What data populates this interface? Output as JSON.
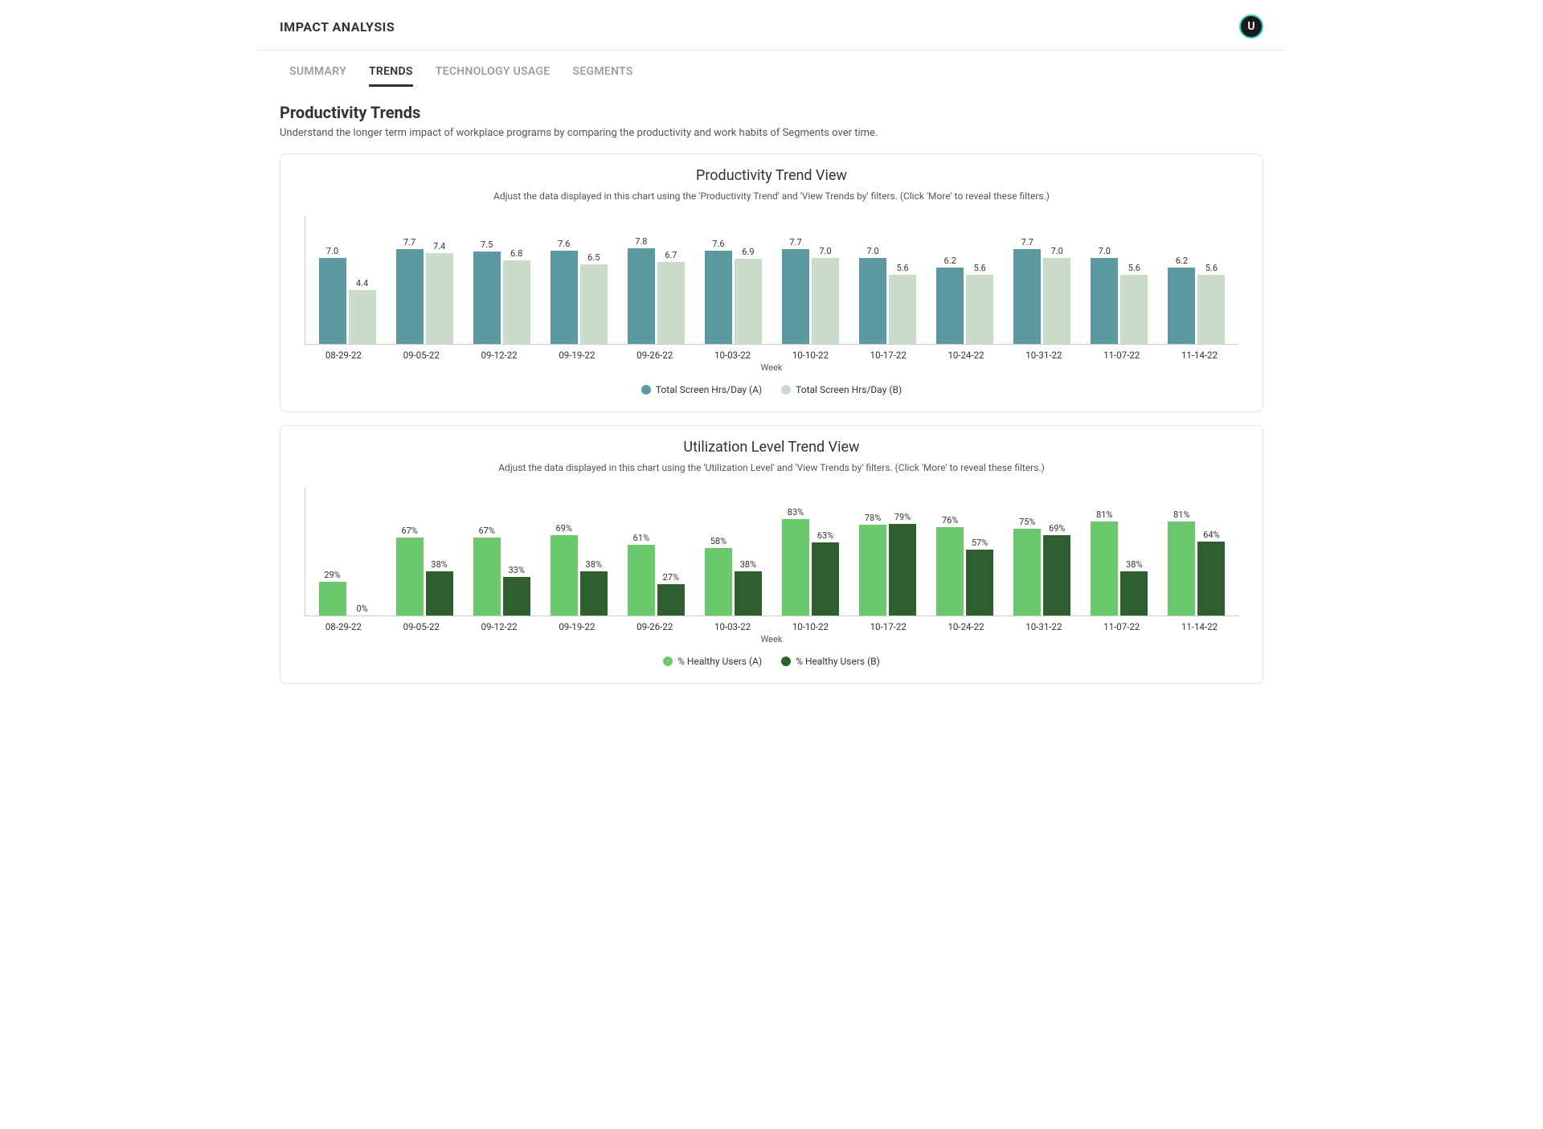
{
  "header": {
    "title": "IMPACT ANALYSIS",
    "avatar_initial": "U"
  },
  "tabs": {
    "items": [
      "SUMMARY",
      "TRENDS",
      "TECHNOLOGY USAGE",
      "SEGMENTS"
    ],
    "active_index": 1
  },
  "section": {
    "title": "Productivity Trends",
    "subtitle": "Understand the longer term impact of workplace programs by comparing the productivity and work habits of Segments over time."
  },
  "colors": {
    "teal_a": "#5a9aa0",
    "teal_b": "#c9dcc9",
    "green_a": "#6cc86c",
    "green_b": "#2f5f2f"
  },
  "chart1": {
    "title": "Productivity Trend View",
    "subtitle": "Adjust the data displayed in this chart using the 'Productivity Trend' and 'View Trends by' filters. (Click 'More' to reveal these filters.)",
    "xlabel": "Week",
    "legend_a": "Total Screen Hrs/Day (A)",
    "legend_b": "Total Screen Hrs/Day (B)"
  },
  "chart2": {
    "title": "Utilization Level Trend View",
    "subtitle": "Adjust the data displayed in this chart using the 'Utilization Level' and 'View Trends by' filters. (Click 'More' to reveal these filters.)",
    "xlabel": "Week",
    "legend_a": "% Healthy Users (A)",
    "legend_b": "% Healthy Users (B)"
  },
  "chart_data": [
    {
      "type": "bar",
      "title": "Productivity Trend View",
      "xlabel": "Week",
      "ylabel": "",
      "ylim": [
        0,
        8.5
      ],
      "categories": [
        "08-29-22",
        "09-05-22",
        "09-12-22",
        "09-19-22",
        "09-26-22",
        "10-03-22",
        "10-10-22",
        "10-17-22",
        "10-24-22",
        "10-31-22",
        "11-07-22",
        "11-14-22"
      ],
      "series": [
        {
          "name": "Total Screen Hrs/Day (A)",
          "values": [
            7.0,
            7.7,
            7.5,
            7.6,
            7.8,
            7.6,
            7.7,
            7.0,
            6.2,
            7.7,
            7.0,
            6.2
          ]
        },
        {
          "name": "Total Screen Hrs/Day (B)",
          "values": [
            4.4,
            7.4,
            6.8,
            6.5,
            6.7,
            6.9,
            7.0,
            5.6,
            5.6,
            7.0,
            5.6,
            5.6
          ]
        }
      ],
      "value_suffix": ""
    },
    {
      "type": "bar",
      "title": "Utilization Level Trend View",
      "xlabel": "Week",
      "ylabel": "",
      "ylim": [
        0,
        90
      ],
      "categories": [
        "08-29-22",
        "09-05-22",
        "09-12-22",
        "09-19-22",
        "09-26-22",
        "10-03-22",
        "10-10-22",
        "10-17-22",
        "10-24-22",
        "10-31-22",
        "11-07-22",
        "11-14-22"
      ],
      "series": [
        {
          "name": "% Healthy Users (A)",
          "values": [
            29,
            67,
            67,
            69,
            61,
            58,
            83,
            78,
            76,
            75,
            81,
            81
          ]
        },
        {
          "name": "% Healthy Users (B)",
          "values": [
            0,
            38,
            33,
            38,
            27,
            38,
            63,
            79,
            57,
            69,
            38,
            64
          ]
        }
      ],
      "value_suffix": "%"
    }
  ]
}
